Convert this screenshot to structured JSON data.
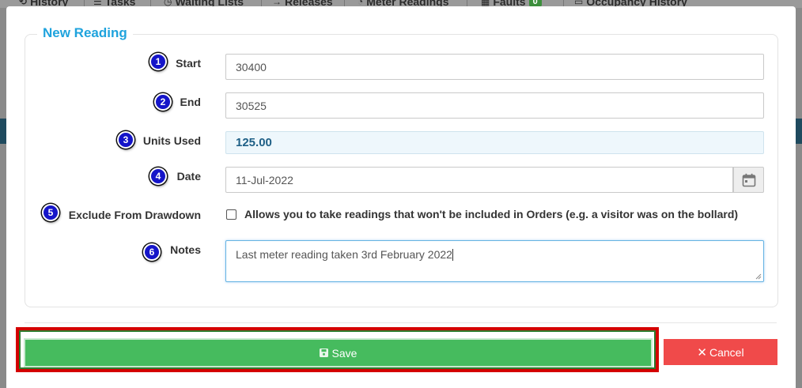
{
  "background_tabs": [
    {
      "label": "History",
      "icon": "history-icon"
    },
    {
      "label": "Tasks",
      "icon": "tasks-icon"
    },
    {
      "label": "Waiting Lists",
      "icon": "clock-icon"
    },
    {
      "label": "Releases",
      "icon": "release-arrow-icon"
    },
    {
      "label": "Meter Readings",
      "icon": "meter-icon"
    },
    {
      "label": "Faults",
      "icon": "faults-icon",
      "badge": "0"
    },
    {
      "label": "Occupancy History",
      "icon": "occupancy-icon"
    }
  ],
  "form": {
    "legend": "New Reading",
    "start": {
      "step": "1",
      "label": "Start",
      "value": "30400"
    },
    "end": {
      "step": "2",
      "label": "End",
      "value": "30525"
    },
    "units_used": {
      "step": "3",
      "label": "Units Used",
      "value": "125.00"
    },
    "date": {
      "step": "4",
      "label": "Date",
      "value": "11-Jul-2022",
      "icon": "calendar-icon"
    },
    "exclude": {
      "step": "5",
      "label": "Exclude From Drawdown",
      "checked": false,
      "help": "Allows you to take readings that won't be included in Orders (e.g. a visitor was on the bollard)"
    },
    "notes": {
      "step": "6",
      "label": "Notes",
      "value": "Last meter reading taken 3rd February 2022"
    }
  },
  "buttons": {
    "save": {
      "label": "Save",
      "icon": "save-icon"
    },
    "cancel": {
      "label": "Cancel",
      "icon": "close-icon"
    }
  },
  "colors": {
    "legend": "#1fa3dd",
    "step_badge": "#1515c9",
    "save": "#46bb5e",
    "cancel": "#f04a4a",
    "highlight": "#d40000"
  }
}
